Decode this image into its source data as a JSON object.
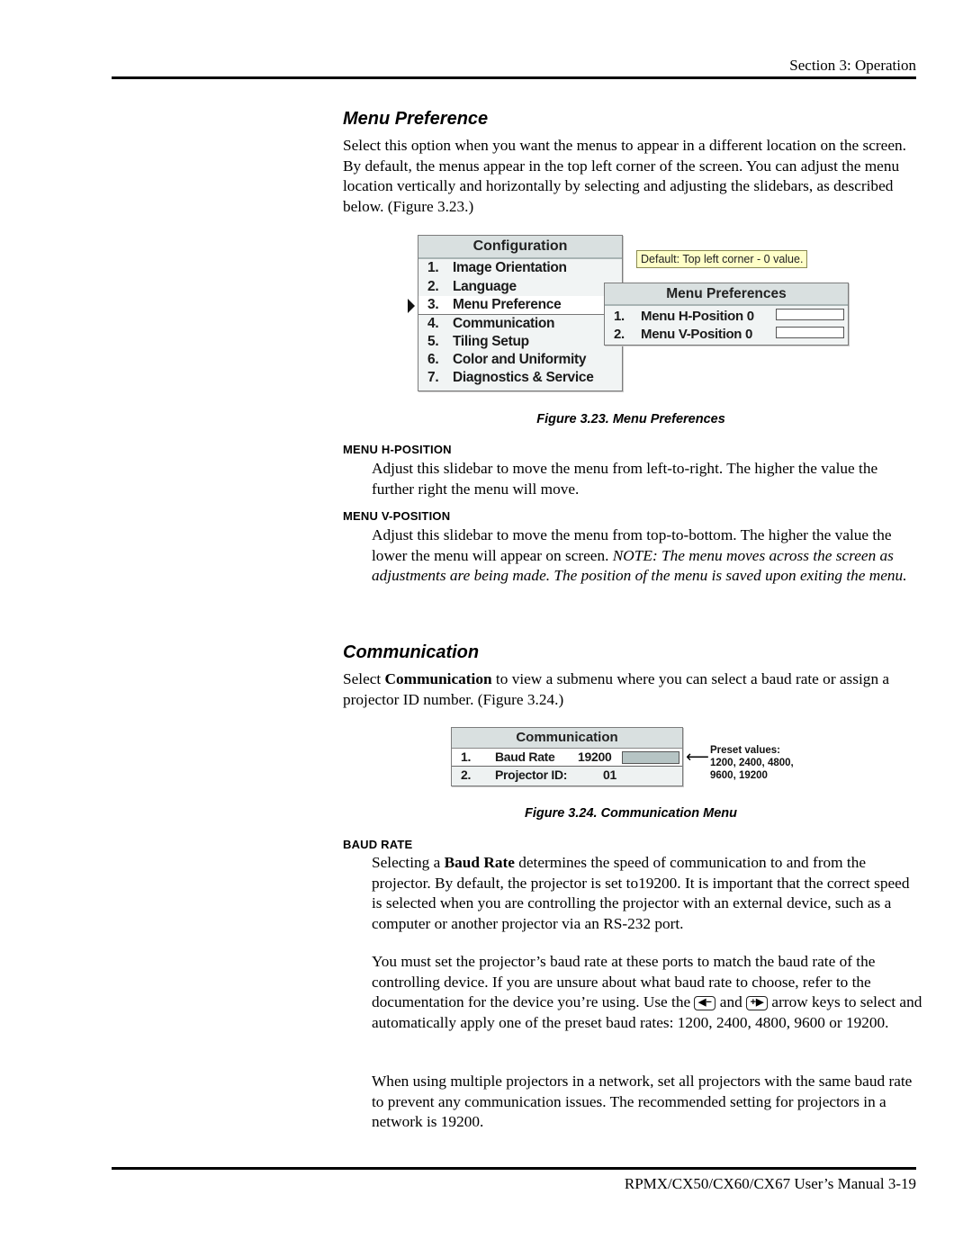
{
  "header": {
    "section": "Section 3: Operation"
  },
  "menu_preference": {
    "heading": "Menu Preference",
    "intro": "Select this option when you want the menus to appear in a different location on the screen. By default, the menus appear in the top left corner of the screen. You can adjust the menu location vertically and horizontally by selecting and adjusting the slidebars, as described below. (Figure 3.23.)"
  },
  "figure_323": {
    "config_menu": {
      "title": "Configuration",
      "items": [
        {
          "num": "1.",
          "label": "Image Orientation"
        },
        {
          "num": "2.",
          "label": "Language"
        },
        {
          "num": "3.",
          "label": "Menu Preference",
          "selected": true
        },
        {
          "num": "4.",
          "label": "Communication"
        },
        {
          "num": "5.",
          "label": "Tiling Setup"
        },
        {
          "num": "6.",
          "label": "Color and Uniformity"
        },
        {
          "num": "7.",
          "label": "Diagnostics & Service"
        }
      ]
    },
    "tooltip": "Default: Top left corner - 0 value.",
    "submenu": {
      "title": "Menu Preferences",
      "items": [
        {
          "num": "1.",
          "label": "Menu H-Position",
          "value": "0",
          "slider_fraction": 0
        },
        {
          "num": "2.",
          "label": "Menu V-Position",
          "value": "0",
          "slider_fraction": 0
        }
      ]
    },
    "caption": "Figure 3.23. Menu Preferences"
  },
  "h_position": {
    "subhead": "MENU H-POSITION",
    "text": "Adjust this slidebar to move the menu from left-to-right. The higher the value the further right the menu will move."
  },
  "v_position": {
    "subhead": "MENU V-POSITION",
    "text_normal": "Adjust this slidebar to move the menu from top-to-bottom. The higher the value the lower the menu will appear on screen. ",
    "text_note": "NOTE: The menu moves across the screen as adjustments are being made. The position of the menu is saved upon exiting the menu."
  },
  "communication": {
    "heading": "Communication",
    "intro_pre": "Select ",
    "intro_bold": "Communication",
    "intro_post": " to view a submenu where you can select a baud rate or assign a projector ID number. (Figure 3.24.)"
  },
  "figure_324": {
    "menu": {
      "title": "Communication",
      "items": [
        {
          "num": "1.",
          "label": "Baud Rate",
          "value": "19200"
        },
        {
          "num": "2.",
          "label": "Projector ID:",
          "value": "01"
        }
      ]
    },
    "note_title": "Preset values:",
    "note_values": "1200, 2400, 4800,",
    "note_values2": "9600, 19200",
    "caption": "Figure 3.24.  Communication Menu"
  },
  "baud_rate": {
    "subhead": "BAUD RATE",
    "p1_pre": "Selecting a ",
    "p1_bold": "Baud Rate",
    "p1_post": " determines the speed of communication to and from the projector. By default, the projector is set to19200. It is important that the correct speed is selected when you are controlling the projector with an external device, such as a computer or another projector via an RS-232 port.",
    "p2_pre": "You must set the projector’s baud rate at these ports to match the baud rate of the controlling device. If you are unsure about what baud rate to choose, refer to the documentation for the device you’re using. Use the ",
    "key_left": "◀−",
    "p2_mid": " and ",
    "key_right": "+▶",
    "p2_post": " arrow keys to select and automatically apply one of the preset baud rates: 1200, 2400, 4800, 9600 or 19200.",
    "p3": "When using multiple projectors in a network, set all projectors with the same baud rate to prevent any communication issues. The recommended setting for projectors in a network is 19200."
  },
  "footer": {
    "manual": "RPMX/CX50/CX60/CX67 User’s Manual  3-19"
  }
}
